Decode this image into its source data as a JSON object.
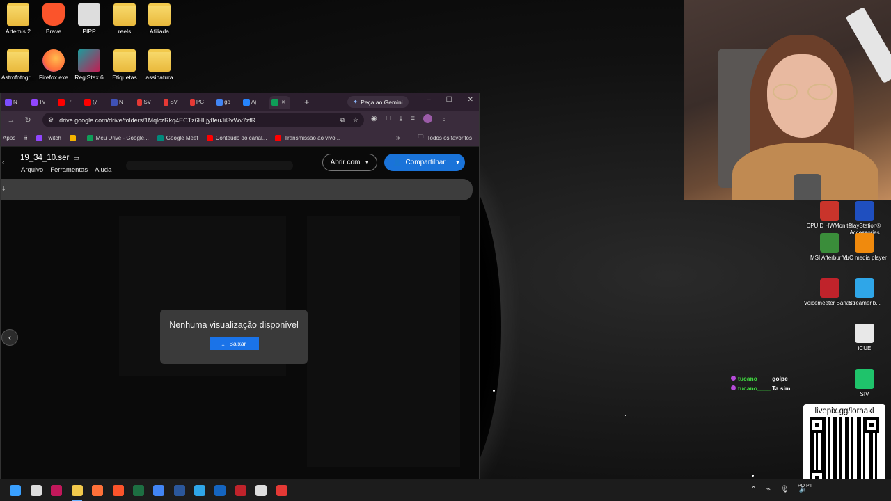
{
  "desktop": {
    "icons_top": [
      {
        "label": "Artemis 2",
        "type": "folder"
      },
      {
        "label": "Brave",
        "type": "brave"
      },
      {
        "label": "PIPP",
        "type": "pipp"
      },
      {
        "label": "reels",
        "type": "folder"
      },
      {
        "label": "Afiliada",
        "type": "folder"
      }
    ],
    "icons_second": [
      {
        "label": "Astrofotogr...",
        "type": "folder"
      },
      {
        "label": "Firefox.exe",
        "type": "firefox"
      },
      {
        "label": "RegiStax 6",
        "type": "registax"
      },
      {
        "label": "Etiquetas",
        "type": "folder"
      },
      {
        "label": "assinatura",
        "type": "folder"
      }
    ],
    "icons_right": [
      {
        "label": "CPUID HWMonitor",
        "color": "#c9342b"
      },
      {
        "label": "PlayStation® Accessories",
        "color": "#1f4fbf"
      },
      {
        "label": "MSI Afterburner",
        "color": "#3a8d3a"
      },
      {
        "label": "VLC media player",
        "color": "#f08a0d"
      },
      {
        "label": "Voicemeeter Banana",
        "color": "#c0232b"
      },
      {
        "label": "Streamer.b...",
        "color": "#2fa6e8"
      },
      {
        "label": "iCUE",
        "color": "#e8e8e8"
      },
      {
        "label": "SIV",
        "color": "#1fc36b"
      }
    ]
  },
  "browser": {
    "tabs": [
      {
        "label": "N",
        "color": "#7c4dff"
      },
      {
        "label": "Tv",
        "color": "#9146ff"
      },
      {
        "label": "Tr",
        "color": "#ff0000"
      },
      {
        "label": "(7",
        "color": "#ff0000"
      },
      {
        "label": "N",
        "color": "#3f51b5"
      },
      {
        "label": "SV",
        "color": "#e53935"
      },
      {
        "label": "SV",
        "color": "#e53935"
      },
      {
        "label": "PC",
        "color": "#e53935"
      },
      {
        "label": "go",
        "color": "#4285f4"
      },
      {
        "label": "Aj",
        "color": "#2684fc"
      },
      {
        "label": "",
        "color": "#0f9d58"
      }
    ],
    "new_tab": "+",
    "gemini_button": "Peça ao Gemini",
    "window_controls": [
      "–",
      "☐",
      "✕"
    ],
    "url": "drive.google.com/drive/folders/1MqlczRkq4ECTz6HLjy8euJil3vWv7zfR",
    "bookmarks": [
      {
        "label": "Apps",
        "color": ""
      },
      {
        "label": "Twitch",
        "color": "#9146ff"
      },
      {
        "label": "",
        "color": "#f6b400"
      },
      {
        "label": "Meu Drive - Google...",
        "color": "#0f9d58"
      },
      {
        "label": "Google Meet",
        "color": "#00897b"
      },
      {
        "label": "Conteúdo do canal...",
        "color": "#ff0000"
      },
      {
        "label": "Transmissão ao vivo...",
        "color": "#ff0000"
      }
    ],
    "all_bookmarks": "Todos os favoritos"
  },
  "viewer": {
    "file_name": "19_34_10.ser",
    "menu": [
      "Arquivo",
      "Ferramentas",
      "Ajuda"
    ],
    "open_with": "Abrir com",
    "share": "Compartilhar",
    "no_preview": "Nenhuma visualização disponível",
    "download": "Baixar"
  },
  "chat": [
    {
      "user": "tucano____",
      "message": "golpe"
    },
    {
      "user": "tucano____",
      "message": "Ta sim"
    }
  ],
  "qr_label": "livepix.gg/loraakl",
  "taskbar": {
    "apps": [
      {
        "name": "windows-start",
        "color": "#3aa0ff"
      },
      {
        "name": "search",
        "color": "#ddd"
      },
      {
        "name": "stream-deck",
        "color": "#c2185b"
      },
      {
        "name": "file-explorer",
        "color": "#f2c94c"
      },
      {
        "name": "firefox",
        "color": "#ff7139"
      },
      {
        "name": "brave",
        "color": "#fb542b"
      },
      {
        "name": "excel",
        "color": "#1d6f42"
      },
      {
        "name": "chrome",
        "color": "#4285f4"
      },
      {
        "name": "word",
        "color": "#2b579a"
      },
      {
        "name": "streamerbot",
        "color": "#2fa6e8"
      },
      {
        "name": "lc",
        "color": "#1565c0"
      },
      {
        "name": "voicemeeter",
        "color": "#c0232b"
      },
      {
        "name": "obs",
        "color": "#ddd"
      },
      {
        "name": "media",
        "color": "#e53935"
      }
    ],
    "clock_partial": "PO PT"
  }
}
